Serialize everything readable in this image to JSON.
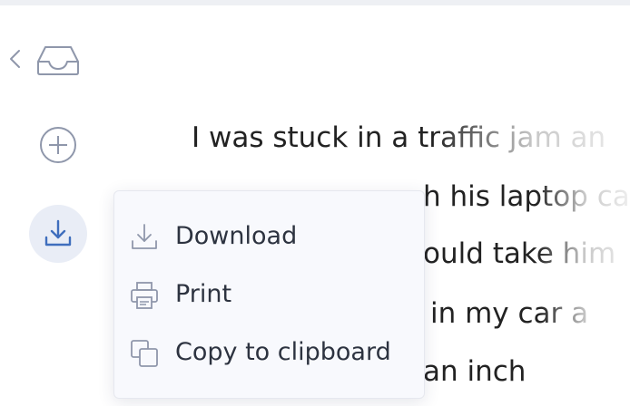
{
  "icons": {
    "back": "chevron-left-icon",
    "inbox": "inbox-icon",
    "add": "plus-circle-icon",
    "download": "download-icon",
    "print": "printer-icon",
    "copy": "copy-icon"
  },
  "colors": {
    "icon_stroke": "#8f97ab",
    "download_icon": "#3f6ebd",
    "download_bg": "#e9edf6",
    "menu_bg": "#f8f9fd",
    "text": "#222222"
  },
  "document": {
    "lines": [
      "I was stuck in a traffic jam an",
      "h his laptop ca",
      "ould take him",
      "in my car a",
      "an inch"
    ]
  },
  "menu": {
    "items": [
      {
        "label": "Download",
        "icon": "download-icon"
      },
      {
        "label": "Print",
        "icon": "printer-icon"
      },
      {
        "label": "Copy to clipboard",
        "icon": "copy-icon"
      }
    ]
  }
}
